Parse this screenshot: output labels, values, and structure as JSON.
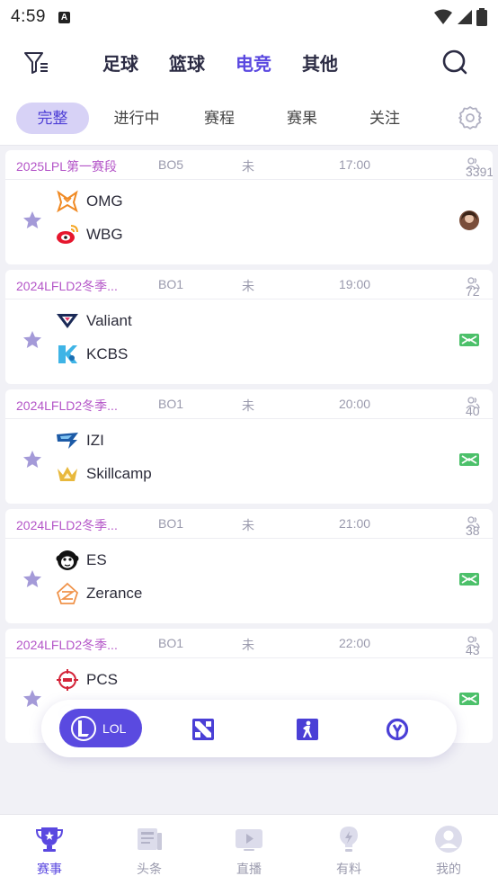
{
  "status_bar": {
    "time": "4:59",
    "notif": "A"
  },
  "sport_tabs": [
    {
      "label": "足球",
      "active": false
    },
    {
      "label": "篮球",
      "active": false
    },
    {
      "label": "电竞",
      "active": true
    },
    {
      "label": "其他",
      "active": false
    }
  ],
  "sub_tabs": [
    {
      "label": "完整",
      "active": true
    },
    {
      "label": "进行中",
      "active": false
    },
    {
      "label": "赛程",
      "active": false
    },
    {
      "label": "赛果",
      "active": false
    },
    {
      "label": "关注",
      "active": false
    }
  ],
  "matches": [
    {
      "league": "2025LPL第一赛段",
      "format": "BO5",
      "status": "未",
      "time": "17:00",
      "viewers": "3391",
      "team1": "OMG",
      "team2": "WBG",
      "indicator": "avatar"
    },
    {
      "league": "2024LFLD2冬季...",
      "format": "BO1",
      "status": "未",
      "time": "19:00",
      "viewers": "72",
      "team1": "Valiant",
      "team2": "KCBS",
      "indicator": "stream"
    },
    {
      "league": "2024LFLD2冬季...",
      "format": "BO1",
      "status": "未",
      "time": "20:00",
      "viewers": "40",
      "team1": "IZI",
      "team2": "Skillcamp",
      "indicator": "stream"
    },
    {
      "league": "2024LFLD2冬季...",
      "format": "BO1",
      "status": "未",
      "time": "21:00",
      "viewers": "38",
      "team1": "ES",
      "team2": "Zerance",
      "indicator": "stream"
    },
    {
      "league": "2024LFLD2冬季...",
      "format": "BO1",
      "status": "未",
      "time": "22:00",
      "viewers": "43",
      "team1": "PCS",
      "team2": "",
      "indicator": "stream"
    }
  ],
  "game_switcher": {
    "active_label": "LOL",
    "games": [
      "lol-icon",
      "dota2-icon",
      "csgo-icon",
      "overwatch-icon"
    ]
  },
  "bottom_nav": [
    {
      "label": "赛事",
      "active": true,
      "icon": "trophy-icon"
    },
    {
      "label": "头条",
      "active": false,
      "icon": "newspaper-icon"
    },
    {
      "label": "直播",
      "active": false,
      "icon": "tv-play-icon"
    },
    {
      "label": "有料",
      "active": false,
      "icon": "lightbulb-icon"
    },
    {
      "label": "我的",
      "active": false,
      "icon": "profile-icon"
    }
  ],
  "colors": {
    "accent": "#5a48e0",
    "league": "#b455c8",
    "star": "#a49ad8",
    "stream": "#4cc06a",
    "background": "#f1f1f6"
  }
}
